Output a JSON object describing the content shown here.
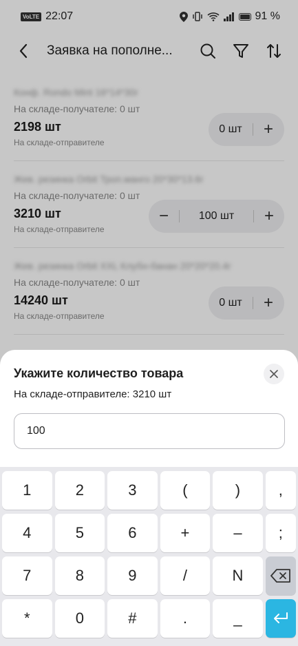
{
  "statusbar": {
    "time": "22:07",
    "volte": "VoLTE",
    "battery": "91 %"
  },
  "header": {
    "title": "Заявка на пополне...",
    "icons": [
      "back-arrow-icon",
      "search-icon",
      "filter-icon",
      "sort-icon"
    ]
  },
  "items": [
    {
      "name": "Конф. Rondo Mint 16*14*30г",
      "receiver": "На складе-получателе: 0 шт",
      "qty": "2198 шт",
      "sender_label": "На складе-отправителе",
      "stepper_value": "0 шт"
    },
    {
      "name": "Жев. резинка Orbit Троп.манго 20*30*13.6г",
      "receiver": "На складе-получателе: 0 шт",
      "qty": "3210 шт",
      "sender_label": "На складе-отправителе",
      "stepper_value": "100 шт"
    },
    {
      "name": "Жев. резинка Orbit XXL Клубн-банан 20*20*20.4г",
      "receiver": "На складе-получателе: 0 шт",
      "qty": "14240 шт",
      "sender_label": "На складе-отправителе",
      "stepper_value": "0 шт"
    }
  ],
  "sheet": {
    "title": "Укажите количество товара",
    "subtitle": "На складе-отправителе: 3210  шт",
    "input_value": "100"
  },
  "keyboard": {
    "rows": [
      [
        "1",
        "2",
        "3",
        "(",
        ")",
        ","
      ],
      [
        "4",
        "5",
        "6",
        "+",
        "–",
        ";"
      ],
      [
        "7",
        "8",
        "9",
        "/",
        "N",
        "⌫"
      ],
      [
        "*",
        "0",
        "#",
        ".",
        "_",
        "⏎"
      ]
    ]
  },
  "colors": {
    "accent": "#2bb6e2",
    "overlay": "rgba(0,0,0,0.22)"
  }
}
